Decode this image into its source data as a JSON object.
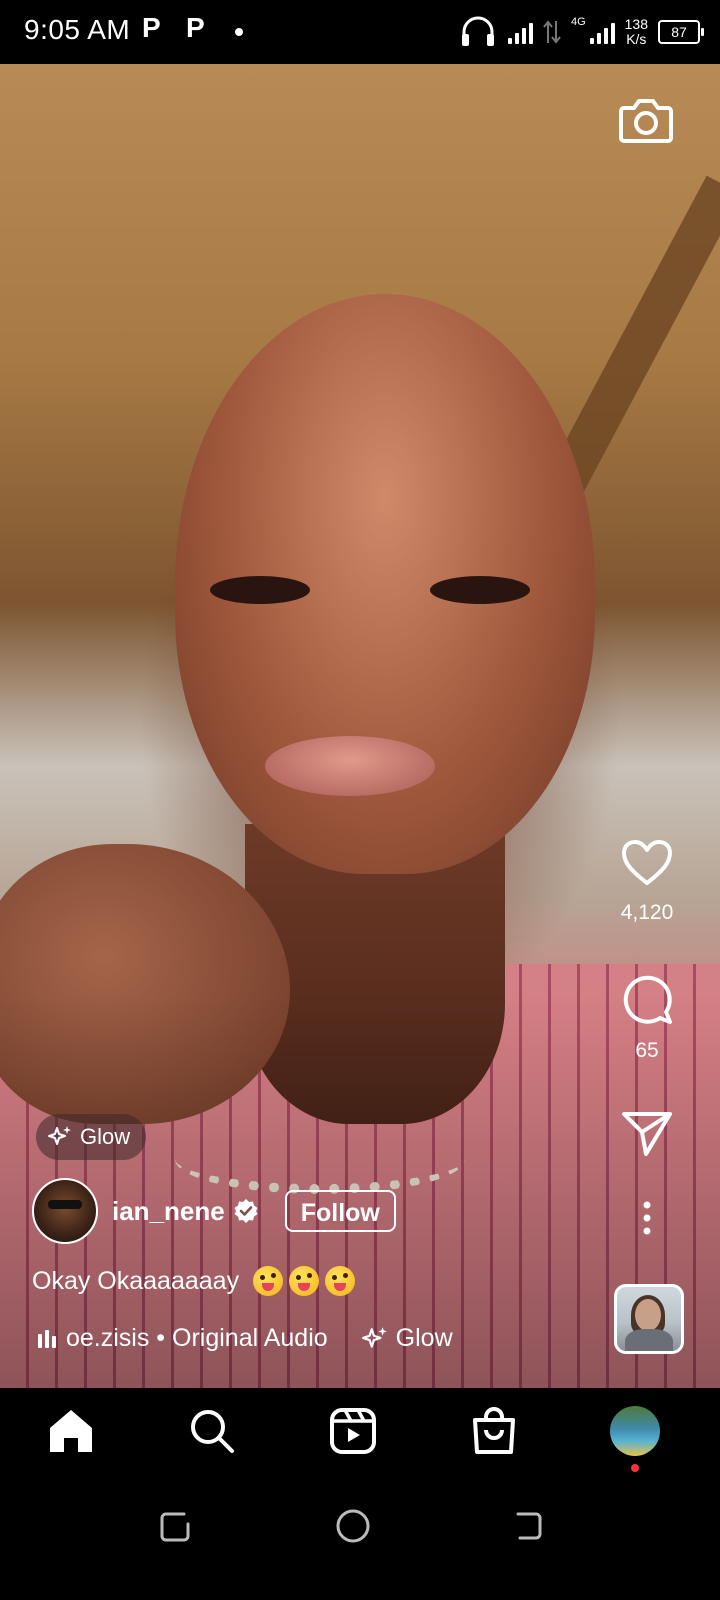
{
  "status_bar": {
    "time": "9:05 AM",
    "p1": "P",
    "p2": "P",
    "network": "4G",
    "speed_value": "138",
    "speed_unit": "K/s",
    "battery": "87"
  },
  "reel": {
    "camera_icon": "camera-icon",
    "likes": "4,120",
    "comments": "65",
    "effect_chip": "Glow",
    "username": "ian_nene",
    "follow_label": "Follow",
    "caption_text": "Okay Okaaaaaaay",
    "caption_emojis": [
      "zany-face-emoji",
      "zany-face-emoji",
      "zany-face-emoji"
    ],
    "audio_text": "oe.zisis • Original Audio",
    "audio_effect": "Glow"
  },
  "bottom_nav": {
    "items": [
      "home-icon",
      "search-icon",
      "reels-icon",
      "shop-icon",
      "profile-avatar"
    ]
  },
  "system_nav": {
    "items": [
      "recent-apps-button",
      "home-button",
      "back-button"
    ]
  }
}
